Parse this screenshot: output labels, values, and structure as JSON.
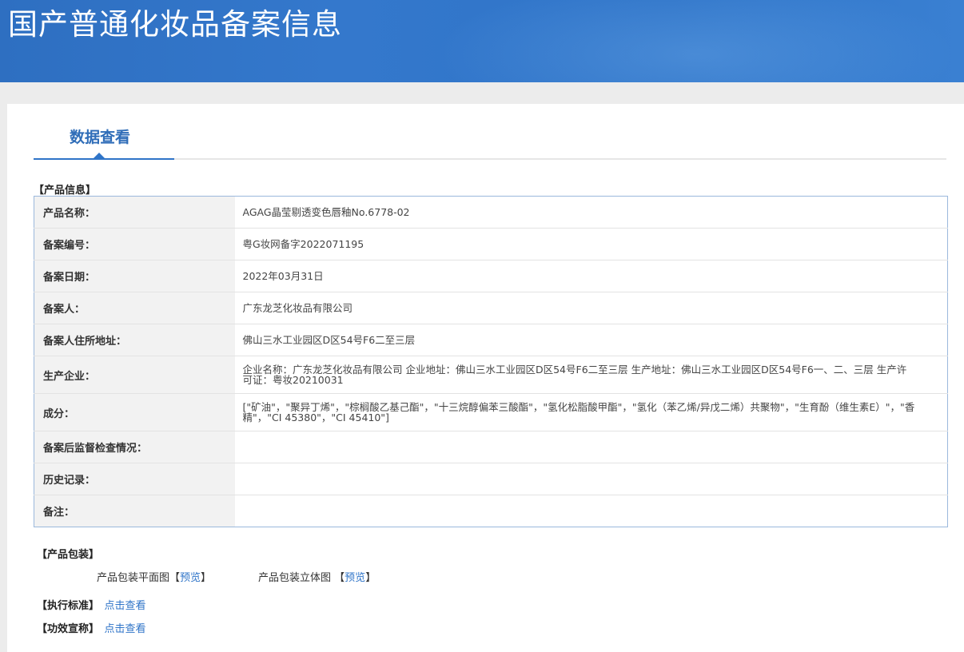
{
  "header": {
    "title": "国产普通化妆品备案信息"
  },
  "tab": {
    "label": "数据查看"
  },
  "sections": {
    "product_info": "【产品信息】",
    "packaging": "【产品包装】",
    "standard": "【执行标准】",
    "efficacy": "【功效宣称】"
  },
  "product_info": [
    {
      "label": "产品名称：",
      "value": "AGAG晶莹剔透变色唇釉No.6778-02"
    },
    {
      "label": "备案编号：",
      "value": "粤G妆网备字2022071195"
    },
    {
      "label": "备案日期：",
      "value": "2022年03月31日"
    },
    {
      "label": "备案人：",
      "value": "广东龙芝化妆品有限公司"
    },
    {
      "label": "备案人住所地址：",
      "value": "佛山三水工业园区D区54号F6二至三层"
    },
    {
      "label": "生产企业：",
      "value": "企业名称：广东龙芝化妆品有限公司 企业地址：佛山三水工业园区D区54号F6二至三层 生产地址：佛山三水工业园区D区54号F6一、二、三层 生产许可证：粤妆20210031"
    },
    {
      "label": "成分：",
      "value": "[\"矿油\"，\"聚异丁烯\"，\"棕榈酸乙基己酯\"，\"十三烷醇偏苯三酸酯\"，\"氢化松脂酸甲酯\"，\"氢化（苯乙烯/异戊二烯）共聚物\"，\"生育酚（维生素E）\"，\"香精\"，\"CI 45380\"，\"CI 45410\"]"
    },
    {
      "label": "备案后监督检查情况：",
      "value": ""
    },
    {
      "label": "历史记录：",
      "value": ""
    },
    {
      "label": "备注：",
      "value": ""
    }
  ],
  "packaging": {
    "flat_label": "产品包装平面图",
    "stereo_label": "产品包装立体图",
    "preview": "预览",
    "bracket_open": "【",
    "bracket_close": "】"
  },
  "links": {
    "view": "点击查看"
  },
  "colors": {
    "header_blue": "#2f74c8",
    "link_blue": "#2f74c8",
    "table_border": "#9bb8dc",
    "label_bg": "#f2f2f2"
  }
}
